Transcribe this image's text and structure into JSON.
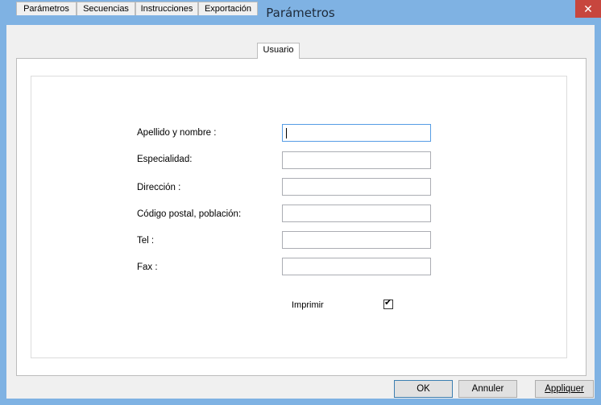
{
  "window": {
    "title": "Parámetros",
    "close_glyph": "✕"
  },
  "tabs": [
    {
      "label": "Parámetros"
    },
    {
      "label": "Secuencias"
    },
    {
      "label": "Instrucciones"
    },
    {
      "label": "Exportación"
    },
    {
      "label": "Usuario",
      "active": true
    }
  ],
  "form": {
    "fields": [
      {
        "label": "Apellido y nombre :",
        "value": ""
      },
      {
        "label": "Especialidad:",
        "value": ""
      },
      {
        "label": "Dirección :",
        "value": ""
      },
      {
        "label": "Código postal, población:",
        "value": ""
      },
      {
        "label": "Tel :",
        "value": ""
      },
      {
        "label": "Fax :",
        "value": ""
      }
    ],
    "print_label": "Imprimir",
    "print_checked": true,
    "check_glyph": "✔"
  },
  "buttons": {
    "ok": "OK",
    "cancel": "Annuler",
    "apply": "Appliquer"
  },
  "colors": {
    "titlebar": "#7fb2e3",
    "close": "#c7463e",
    "focus_border": "#569de5"
  }
}
